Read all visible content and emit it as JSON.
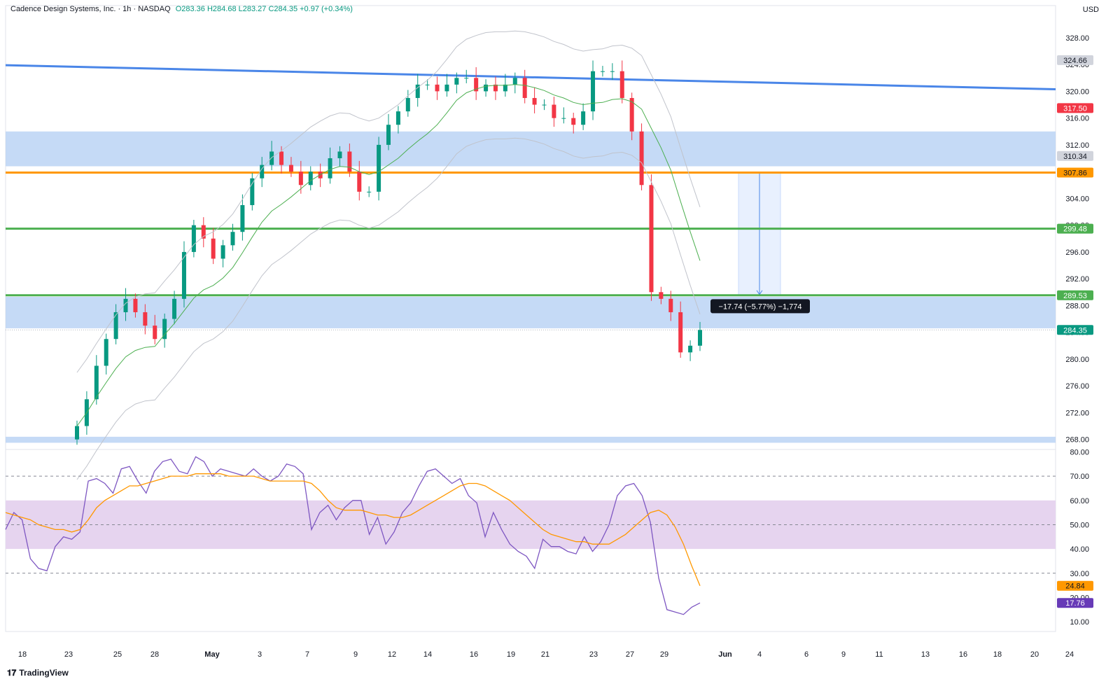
{
  "header": {
    "symbol": "Cadence Design Systems, Inc. · 1h · NASDAQ",
    "open": "O283.36",
    "high": "H284.68",
    "low": "L283.27",
    "close": "C284.35",
    "change": "+0.97 (+0.34%)"
  },
  "currency": "USD",
  "brand": "TradingView",
  "measure_label": "−17.74 (−5.77%) −1,774",
  "chart_data": [
    {
      "type": "candlestick",
      "panel": "price",
      "yaxis_ticks": [
        "328.00",
        "324.00",
        "320.00",
        "316.00",
        "312.00",
        "308.00",
        "304.00",
        "300.00",
        "296.00",
        "292.00",
        "288.00",
        "284.00",
        "280.00",
        "276.00",
        "272.00",
        "268.00"
      ],
      "ylim": [
        266.5,
        330.5
      ],
      "xaxis_ticks": [
        "18",
        "23",
        "25",
        "28",
        "May",
        "3",
        "7",
        "9",
        "12",
        "14",
        "16",
        "19",
        "21",
        "23",
        "27",
        "29",
        "Jun",
        "4",
        "6",
        "9",
        "11",
        "13",
        "16",
        "18",
        "20",
        "24"
      ],
      "last": {
        "open": 283.36,
        "high": 284.68,
        "low": 283.27,
        "close": 284.35
      },
      "close_series": [
        270,
        274,
        279,
        283,
        287,
        289,
        287,
        285,
        283,
        286,
        289,
        296,
        300,
        298,
        295,
        297,
        299,
        303,
        307,
        309,
        311,
        309,
        308,
        306,
        308,
        307,
        310,
        311,
        308,
        305,
        305,
        312,
        315,
        317,
        319,
        321,
        321,
        320,
        321,
        322,
        322,
        320,
        321,
        320,
        321,
        322,
        319,
        318,
        318,
        316,
        316,
        315,
        317,
        323,
        323,
        323,
        319,
        314,
        306,
        290,
        289,
        287,
        281,
        282,
        284.35
      ],
      "candle_color_up": "#089981",
      "candle_color_down": "#f23645",
      "price_labels": [
        {
          "value": "324.66",
          "color": "#d1d4dc",
          "text_color": "#131722"
        },
        {
          "value": "317.50",
          "color": "#f23645",
          "text_color": "#ffffff"
        },
        {
          "value": "310.34",
          "color": "#d1d4dc",
          "text_color": "#131722"
        },
        {
          "value": "307.86",
          "color": "#ff9800",
          "text_color": "#131722"
        },
        {
          "value": "299.48",
          "color": "#4caf50",
          "text_color": "#ffffff"
        },
        {
          "value": "289.53",
          "color": "#4caf50",
          "text_color": "#ffffff"
        },
        {
          "value": "284.35",
          "color": "#089981",
          "text_color": "#ffffff"
        }
      ],
      "horizontal_lines": [
        {
          "value": 307.86,
          "color": "#ff9800"
        },
        {
          "value": 299.48,
          "color": "#4caf50"
        },
        {
          "value": 289.53,
          "color": "#4caf50"
        }
      ],
      "trendline": {
        "from": 323.9,
        "to": 320.3,
        "color": "#4a86e8"
      },
      "zones": [
        {
          "from": 308.8,
          "to": 314.0,
          "color": "#bbd3f5"
        },
        {
          "from": 284.6,
          "to": 289.3,
          "color": "#bbd3f5"
        },
        {
          "from": 267.5,
          "to": 268.4,
          "color": "#bbd3f5"
        }
      ],
      "measure": {
        "from": 307.86,
        "to": 289.53,
        "change": -17.74,
        "percent": -5.77,
        "ticks": -1774
      }
    },
    {
      "type": "line",
      "panel": "rsi",
      "yaxis_ticks": [
        "80.00",
        "70.00",
        "60.00",
        "50.00",
        "40.00",
        "30.00",
        "20.00",
        "10.00"
      ],
      "ylim": [
        6,
        81
      ],
      "band": [
        40,
        60
      ],
      "levels": [
        70,
        50,
        30
      ],
      "series": [
        {
          "color": "#7e57c2",
          "last": "17.76",
          "values": [
            48,
            55,
            52,
            36,
            32,
            31,
            41,
            45,
            44,
            47,
            68,
            69,
            67,
            63,
            73,
            74,
            68,
            63,
            72,
            76,
            77,
            72,
            71,
            78,
            76,
            70,
            73,
            72,
            71,
            70,
            73,
            70,
            68,
            70,
            75,
            74,
            71,
            48,
            55,
            58,
            52,
            57,
            60,
            60,
            46,
            53,
            42,
            47,
            55,
            59,
            66,
            72,
            73,
            70,
            67,
            69,
            62,
            59,
            45,
            55,
            48,
            42,
            39,
            37,
            32,
            44,
            41,
            41,
            39,
            38,
            45,
            39,
            43,
            50,
            62,
            66,
            67,
            62,
            51,
            28,
            15,
            14,
            13,
            16,
            17.76
          ]
        },
        {
          "color": "#ff9800",
          "last": "24.84",
          "values": [
            55,
            54,
            53,
            52,
            50,
            49,
            48,
            48,
            47,
            48,
            52,
            57,
            60,
            62,
            64,
            66,
            66,
            67,
            68,
            69,
            70,
            70,
            70,
            71,
            71,
            71,
            71,
            70,
            70,
            70,
            70,
            69,
            68,
            68,
            68,
            68,
            68,
            67,
            64,
            60,
            57,
            56,
            56,
            56,
            55,
            54,
            54,
            53,
            53,
            54,
            56,
            58,
            60,
            62,
            64,
            66,
            67,
            67,
            66,
            64,
            62,
            60,
            57,
            54,
            51,
            48,
            46,
            45,
            44,
            43,
            43,
            42,
            42,
            42,
            44,
            46,
            49,
            52,
            55,
            56,
            54,
            49,
            42,
            33,
            24.84
          ]
        }
      ],
      "price_labels": [
        {
          "value": "24.84",
          "color": "#ff9800",
          "text_color": "#131722"
        },
        {
          "value": "17.76",
          "color": "#673ab7",
          "text_color": "#ffffff"
        }
      ]
    }
  ]
}
